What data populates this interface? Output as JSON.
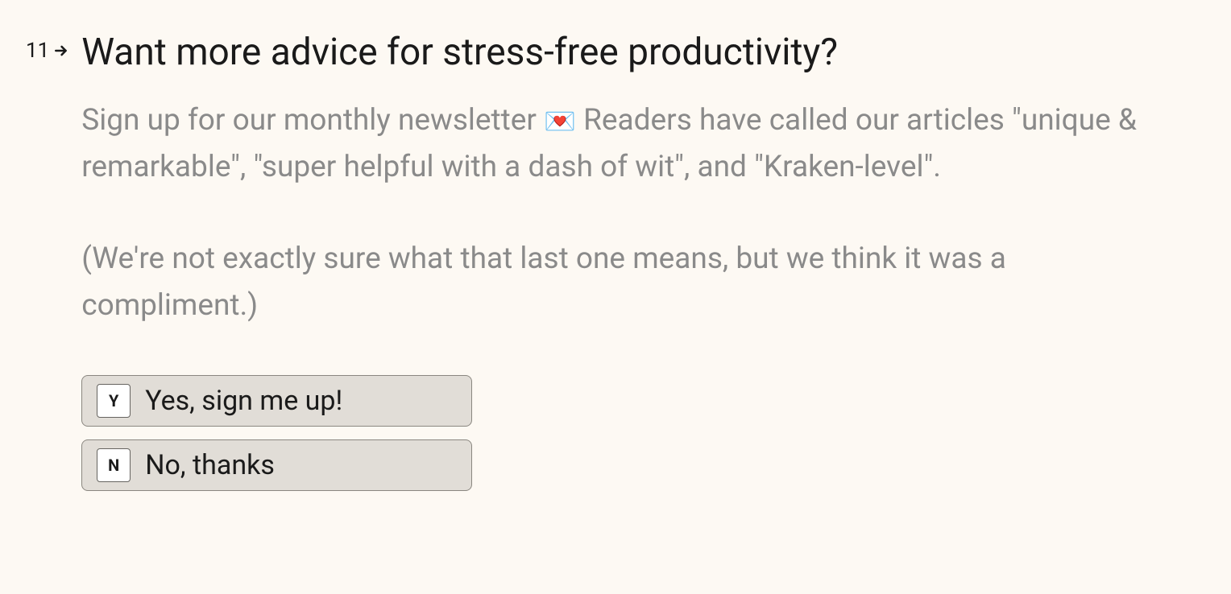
{
  "question": {
    "number": "11",
    "title": "Want more advice for stress-free productivity?",
    "description_part1": "Sign up for our monthly newsletter ",
    "emoji": "💌",
    "description_part2": " Readers have called our articles \"unique & remarkable\", \"super helpful with a dash of wit\", and \"Kraken-level\".",
    "description_part3": "(We're not exactly sure what that last one means, but we think it was a compliment.)"
  },
  "options": [
    {
      "key": "Y",
      "label": "Yes, sign me up!"
    },
    {
      "key": "N",
      "label": "No, thanks"
    }
  ]
}
